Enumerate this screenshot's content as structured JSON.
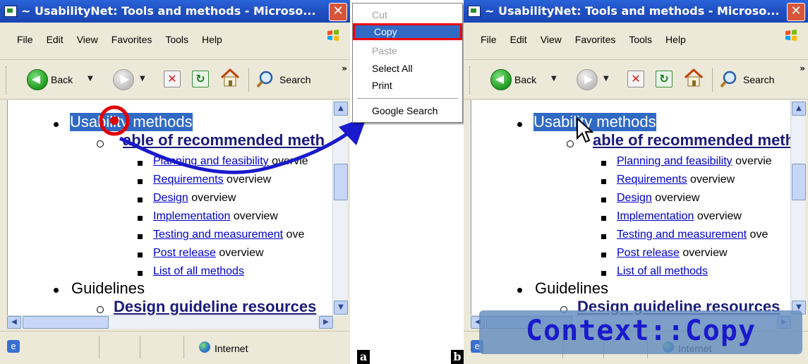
{
  "window_title": "~ UsabilityNet: Tools and methods - Microso...",
  "menu": [
    "File",
    "Edit",
    "View",
    "Favorites",
    "Tools",
    "Help"
  ],
  "toolbar": {
    "back_label": "Back",
    "search_label": "Search",
    "overflow": "»"
  },
  "content": {
    "item1": {
      "selected_text": "Usability methods"
    },
    "item1_sub": "Table of recommended methods",
    "item1_sub_a": "able of recommended meth",
    "item1_sub_b": "able of recommended meth",
    "links": [
      {
        "link": "Planning and feasibility",
        "suffix": " overvie"
      },
      {
        "link": "Requirements",
        "suffix": " overview"
      },
      {
        "link": "Design",
        "suffix": " overview"
      },
      {
        "link": "Implementation",
        "suffix": " overview"
      },
      {
        "link": "Testing and measurement",
        "suffix": " ove"
      },
      {
        "link": "Post release",
        "suffix": " overview"
      },
      {
        "link": "List of all methods",
        "suffix": ""
      }
    ],
    "item2": "Guidelines",
    "item2_sub": "Design guideline resources"
  },
  "statusbar": {
    "zone": "Internet"
  },
  "context_menu": {
    "items": [
      {
        "label": "Cut",
        "enabled": false
      },
      {
        "label": "Copy",
        "enabled": true,
        "highlighted": true
      },
      {
        "label": "Paste",
        "enabled": false
      },
      {
        "label": "Select All",
        "enabled": true
      },
      {
        "label": "Print",
        "enabled": true
      },
      {
        "label": "Google Search",
        "enabled": true
      }
    ]
  },
  "overlay_label": "Context::Copy",
  "panel_labels": {
    "a": "a",
    "b": "b"
  },
  "colors": {
    "selection": "#316ac5",
    "titlebar": "#2a63d8",
    "annotation_red": "#e00000",
    "annotation_blue": "#1a1acc"
  }
}
